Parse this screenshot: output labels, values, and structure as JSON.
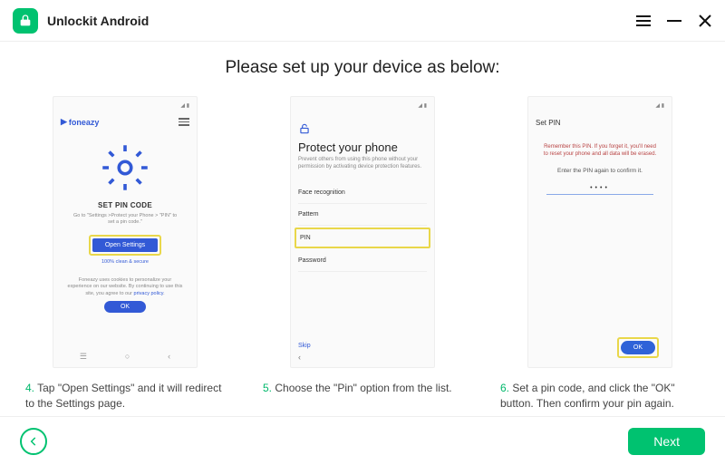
{
  "app": {
    "title": "Unlockit Android"
  },
  "heading": "Please set up your device as below:",
  "phone1": {
    "brand": "foneazy",
    "title": "SET PIN CODE",
    "sub": "Go to \"Settings >Protect your Phone > \"PIN\" to set a pin code.\"",
    "open": "Open Settings",
    "clean": "100% clean & secure",
    "cookie_text": "Foneazy uses cookies to personalize your experience on our website. By continuing to use this site, you agree to our ",
    "cookie_link": "privacy policy",
    "ok": "OK"
  },
  "phone2": {
    "title": "Protect your phone",
    "desc": "Prevent others from using this phone without your permission by activating device protection features.",
    "items": [
      "Face recognition",
      "Pattern",
      "PIN",
      "Password"
    ],
    "skip": "Skip"
  },
  "phone3": {
    "title": "Set PIN",
    "warn": "Remember this PIN. If you forget it, you'll need to reset your phone and all data will be erased.",
    "msg": "Enter the PIN again to confirm it.",
    "pin": "••••",
    "ok": "OK"
  },
  "captions": {
    "c4n": "4.",
    "c4": " Tap \"Open Settings\" and it will redirect to the Settings page.",
    "c5n": "5.",
    "c5": " Choose the \"Pin\" option from the list.",
    "c6n": "6.",
    "c6": " Set a pin code, and click the \"OK\" button. Then confirm your pin again."
  },
  "footer": {
    "next": "Next"
  }
}
